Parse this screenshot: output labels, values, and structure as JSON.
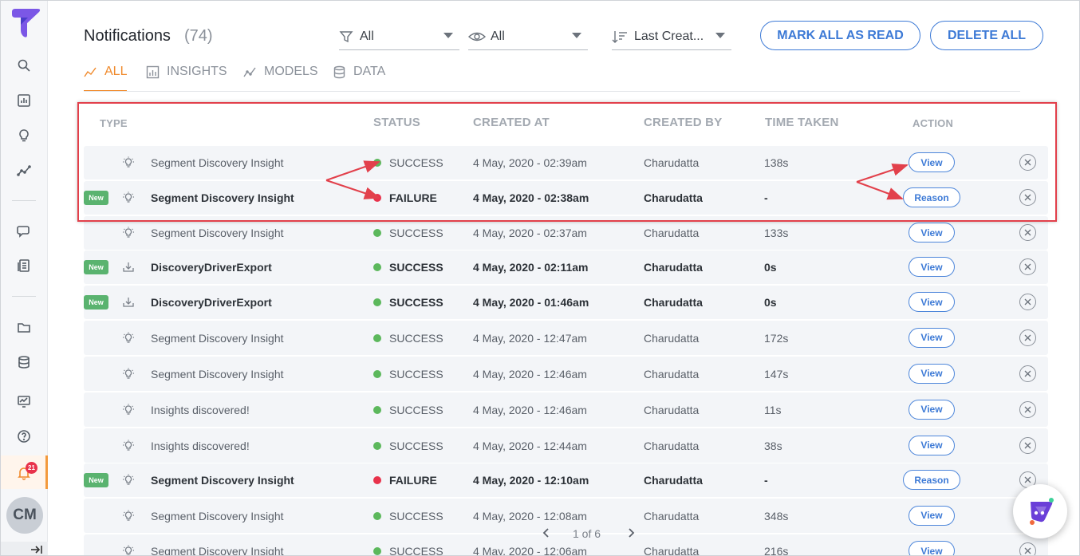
{
  "header": {
    "title": "Notifications",
    "count": "(74)",
    "filter_type": "All",
    "filter_read": "All",
    "sort": "Last Creat...",
    "mark_all_read": "MARK ALL AS READ",
    "delete_all": "DELETE ALL"
  },
  "tabs": [
    {
      "label": "ALL",
      "icon": "line-chart-icon",
      "active": true
    },
    {
      "label": "INSIGHTS",
      "icon": "bar-chart-icon",
      "active": false
    },
    {
      "label": "MODELS",
      "icon": "trend-icon",
      "active": false
    },
    {
      "label": "DATA",
      "icon": "database-icon",
      "active": false
    }
  ],
  "columns": {
    "type": "TYPE",
    "status": "STATUS",
    "created_at": "CREATED AT",
    "created_by": "CREATED BY",
    "time_taken": "TIME TAKEN",
    "action": "ACTION"
  },
  "sidebar": {
    "badge_count": "21",
    "avatar_initials": "CM"
  },
  "new_label": "New",
  "rows": [
    {
      "new": false,
      "icon": "bulb-icon",
      "name": "Segment Discovery Insight",
      "status": "SUCCESS",
      "created_at": "4 May, 2020 - 02:39am",
      "created_by": "Charudatta",
      "time_taken": "138s",
      "action": "View"
    },
    {
      "new": true,
      "icon": "bulb-icon",
      "name": "Segment Discovery Insight",
      "status": "FAILURE",
      "created_at": "4 May, 2020 - 02:38am",
      "created_by": "Charudatta",
      "time_taken": "-",
      "action": "Reason"
    },
    {
      "new": false,
      "icon": "bulb-icon",
      "name": "Segment Discovery Insight",
      "status": "SUCCESS",
      "created_at": "4 May, 2020 - 02:37am",
      "created_by": "Charudatta",
      "time_taken": "133s",
      "action": "View"
    },
    {
      "new": true,
      "icon": "download-icon",
      "name": "DiscoveryDriverExport",
      "status": "SUCCESS",
      "created_at": "4 May, 2020 - 02:11am",
      "created_by": "Charudatta",
      "time_taken": "0s",
      "action": "View"
    },
    {
      "new": true,
      "icon": "download-icon",
      "name": "DiscoveryDriverExport",
      "status": "SUCCESS",
      "created_at": "4 May, 2020 - 01:46am",
      "created_by": "Charudatta",
      "time_taken": "0s",
      "action": "View"
    },
    {
      "new": false,
      "icon": "bulb-icon",
      "name": "Segment Discovery Insight",
      "status": "SUCCESS",
      "created_at": "4 May, 2020 - 12:47am",
      "created_by": "Charudatta",
      "time_taken": "172s",
      "action": "View"
    },
    {
      "new": false,
      "icon": "bulb-icon",
      "name": "Segment Discovery Insight",
      "status": "SUCCESS",
      "created_at": "4 May, 2020 - 12:46am",
      "created_by": "Charudatta",
      "time_taken": "147s",
      "action": "View"
    },
    {
      "new": false,
      "icon": "bulb-icon",
      "name": "Insights discovered!",
      "status": "SUCCESS",
      "created_at": "4 May, 2020 - 12:46am",
      "created_by": "Charudatta",
      "time_taken": "11s",
      "action": "View"
    },
    {
      "new": false,
      "icon": "bulb-icon",
      "name": "Insights discovered!",
      "status": "SUCCESS",
      "created_at": "4 May, 2020 - 12:44am",
      "created_by": "Charudatta",
      "time_taken": "38s",
      "action": "View"
    },
    {
      "new": true,
      "icon": "bulb-icon",
      "name": "Segment Discovery Insight",
      "status": "FAILURE",
      "created_at": "4 May, 2020 - 12:10am",
      "created_by": "Charudatta",
      "time_taken": "-",
      "action": "Reason"
    },
    {
      "new": false,
      "icon": "bulb-icon",
      "name": "Segment Discovery Insight",
      "status": "SUCCESS",
      "created_at": "4 May, 2020 - 12:08am",
      "created_by": "Charudatta",
      "time_taken": "348s",
      "action": "View"
    },
    {
      "new": false,
      "icon": "bulb-icon",
      "name": "Segment Discovery Insight",
      "status": "SUCCESS",
      "created_at": "4 May, 2020 - 12:06am",
      "created_by": "Charudatta",
      "time_taken": "216s",
      "action": "View"
    }
  ],
  "pagination": {
    "label": "1 of 6"
  },
  "colors": {
    "accent_orange": "#f08a2c",
    "primary_blue": "#3d7ad6",
    "success_green": "#5cb85c",
    "failure_red": "#e8324b",
    "new_badge_green": "#5ab36f",
    "annotation_red": "#e2404b"
  }
}
